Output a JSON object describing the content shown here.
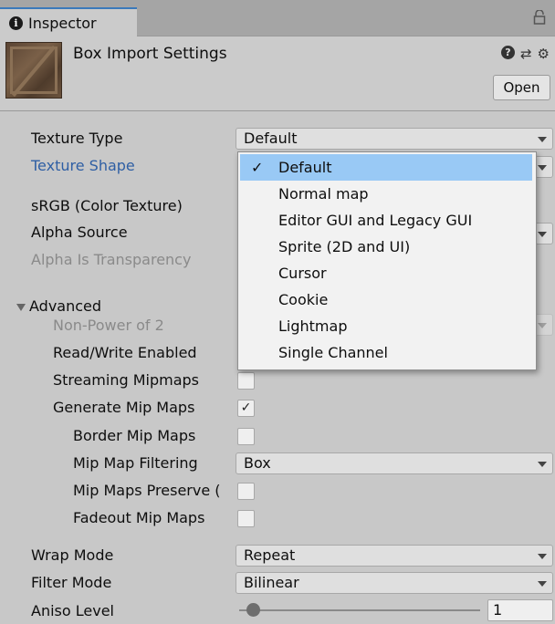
{
  "tab": {
    "title": "Inspector"
  },
  "header": {
    "title": "Box Import Settings",
    "open_label": "Open"
  },
  "icons": {
    "help": "?",
    "presets": "⇄",
    "settings": "⚙"
  },
  "fields": {
    "texture_type": {
      "label": "Texture Type",
      "value": "Default"
    },
    "texture_shape": {
      "label": "Texture Shape"
    },
    "srgb": {
      "label": "sRGB (Color Texture)"
    },
    "alpha_source": {
      "label": "Alpha Source"
    },
    "alpha_is_transparency": {
      "label": "Alpha Is Transparency"
    },
    "advanced": {
      "label": "Advanced"
    },
    "non_power_of_2": {
      "label": "Non-Power of 2"
    },
    "read_write": {
      "label": "Read/Write Enabled"
    },
    "streaming_mipmaps": {
      "label": "Streaming Mipmaps",
      "checked": false
    },
    "generate_mip_maps": {
      "label": "Generate Mip Maps",
      "checked": true,
      "check_glyph": "✓"
    },
    "border_mip_maps": {
      "label": "Border Mip Maps",
      "checked": false
    },
    "mip_map_filtering": {
      "label": "Mip Map Filtering",
      "value": "Box"
    },
    "mip_maps_preserve": {
      "label": "Mip Maps Preserve (",
      "checked": false
    },
    "fadeout_mip_maps": {
      "label": "Fadeout Mip Maps",
      "checked": false
    },
    "wrap_mode": {
      "label": "Wrap Mode",
      "value": "Repeat"
    },
    "filter_mode": {
      "label": "Filter Mode",
      "value": "Bilinear"
    },
    "aniso_level": {
      "label": "Aniso Level",
      "value": "1",
      "slider_fraction": 0.06
    }
  },
  "dropdown": {
    "check_glyph": "✓",
    "options": [
      "Default",
      "Normal map",
      "Editor GUI and Legacy GUI",
      "Sprite (2D and UI)",
      "Cursor",
      "Cookie",
      "Lightmap",
      "Single Channel"
    ],
    "selected_index": 0
  },
  "colors": {
    "selection": "#99c9f5",
    "accent_label": "#2f5fa4",
    "tab_accent": "#3a79bb"
  }
}
